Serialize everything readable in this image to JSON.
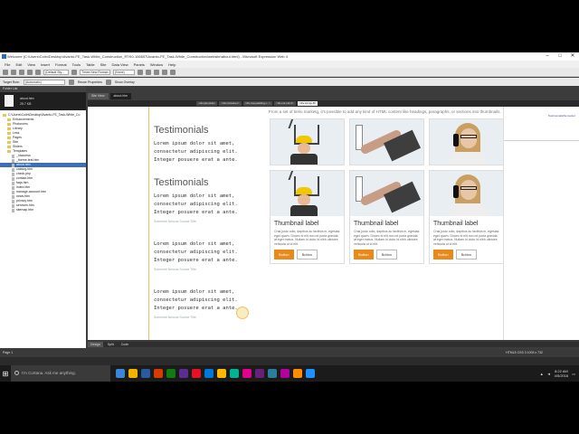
{
  "window": {
    "title": "Welcome (C:\\Users\\Colin\\Desktop\\Avanto-FE_Task-White_Construction_RTK0-106657\\Avanto-FE_Task-White_Construction\\website\\about.html) - Microsoft Expression Web 4",
    "minimize": "–",
    "maximize": "□",
    "close": "✕"
  },
  "menu": [
    "File",
    "Edit",
    "View",
    "Insert",
    "Format",
    "Tools",
    "Table",
    "Site",
    "Data View",
    "Panels",
    "Window",
    "Help"
  ],
  "toolbar": {
    "style_select": "(Default Sty...",
    "font_select": "Times New Roman",
    "size_select": "(None)",
    "target_rule_label": "Target Rule:",
    "target_rule_value": "(Automatic)",
    "reuse_properties": "Reuse Properties",
    "show_overlay": "Show Overlay"
  },
  "folder_panel": {
    "header": "Folder List",
    "file_name": "about.htm",
    "file_size": "25.7 KB",
    "tree": [
      {
        "label": "C:\\Users\\Colin\\Desktop\\Avanto-FE_Task-White_Co",
        "type": "folder",
        "indent": 0
      },
      {
        "label": "Enhancements",
        "type": "folder",
        "indent": 1
      },
      {
        "label": "Photoroms",
        "type": "folder",
        "indent": 1
      },
      {
        "label": "Library",
        "type": "folder",
        "indent": 1
      },
      {
        "label": "Less",
        "type": "folder",
        "indent": 1
      },
      {
        "label": "Pages",
        "type": "folder",
        "indent": 1
      },
      {
        "label": "Site",
        "type": "folder",
        "indent": 1
      },
      {
        "label": "Sliders",
        "type": "folder",
        "indent": 1
      },
      {
        "label": "Templates",
        "type": "folder",
        "indent": 1
      },
      {
        "label": "_htaccess",
        "type": "file",
        "indent": 2
      },
      {
        "label": "_theme-test.htm",
        "type": "file",
        "indent": 2
      },
      {
        "label": "about.htm",
        "type": "file",
        "indent": 2,
        "selected": true
      },
      {
        "label": "catalog.htm",
        "type": "file",
        "indent": 2
      },
      {
        "label": "check.php",
        "type": "file",
        "indent": 2
      },
      {
        "label": "contact.htm",
        "type": "file",
        "indent": 2
      },
      {
        "label": "faqs.htm",
        "type": "file",
        "indent": 2
      },
      {
        "label": "index.htm",
        "type": "file",
        "indent": 2
      },
      {
        "label": "manage-account.htm",
        "type": "file",
        "indent": 2
      },
      {
        "label": "news.htm",
        "type": "file",
        "indent": 2
      },
      {
        "label": "privacy.htm",
        "type": "file",
        "indent": 2
      },
      {
        "label": "services.htm",
        "type": "file",
        "indent": 2
      },
      {
        "label": "sitemap.htm",
        "type": "file",
        "indent": 2
      }
    ]
  },
  "doc_tabs": [
    "Site View",
    "about.htm"
  ],
  "tag_selector": [
    "<div.qfe-wide>",
    "<div.container>",
    "<div.row.padding-t...>",
    "<div.col-md-4>",
    "<div.col-sp-8>"
  ],
  "canvas": {
    "right_link": "Testimonials/Semester",
    "intro_text": "From a set of tirelo marketg, it's possible to add any kind of HTML content like headings, paragraphs, or sections into thumbnails.",
    "testimonials": [
      {
        "heading": "Testimonials",
        "quote": "Lorem ipsum dolor sit amet, consectetur adipiscing elit. Integer posuere erat a ante.",
        "source": ""
      },
      {
        "heading": "Testimonials",
        "quote": "Lorem ipsum dolor sit amet, consectetur adipiscing elit. Integer posuere erat a ante.",
        "source": "Someone famous Source Title"
      },
      {
        "heading": "",
        "quote": "Lorem ipsum dolor sit amet, consectetur adipiscing elit. Integer posuere erat a ante.",
        "source": "Someone famous Source Title"
      },
      {
        "heading": "",
        "quote": "Lorem ipsum dolor sit amet, consectetur adipiscing elit. Integer posuere erat a ante.",
        "source": "Someone famous Source Title"
      }
    ],
    "cards": [
      {
        "image": "worker-house",
        "title": "",
        "desc": "",
        "primary": "",
        "secondary": ""
      },
      {
        "image": "painter-roller",
        "title": "",
        "desc": "",
        "primary": "",
        "secondary": ""
      },
      {
        "image": "woman-phone",
        "title": "",
        "desc": "",
        "primary": "",
        "secondary": ""
      },
      {
        "image": "worker-house",
        "title": "Thumbnail label",
        "desc": "Cras justo odio, dapibus ac facilisis in, egestas eget quam. Donec id elit non mi porta gravida at eget metus. Nullam id dolor id nibh ultricies vehicula ut id elit.",
        "primary": "Button",
        "secondary": "Button"
      },
      {
        "image": "painter-roller",
        "title": "Thumbnail label",
        "desc": "Cras justo odio, dapibus ac facilisis in, egestas eget quam. Donec id elit non mi porta gravida at eget metus. Nullam id dolor id nibh ultricies vehicula ut id elit.",
        "primary": "Button",
        "secondary": "Button"
      },
      {
        "image": "woman-phone",
        "title": "Thumbnail label",
        "desc": "Cras justo odio, dapibus ac facilisis in, egestas eget quam. Donec id elit non mi porta gravida at eget metus. Nullam id dolor id nibh ultricies vehicula ut id elit.",
        "primary": "Button",
        "secondary": "Button"
      }
    ]
  },
  "view_tabs": [
    "Design",
    "Split",
    "Code"
  ],
  "status": {
    "left": "Page 1",
    "right": "HTML5   CSS 3   1003 x 732"
  },
  "taskbar": {
    "search_placeholder": "I'm Cortana. Ask me anything.",
    "time": "8:22 AM",
    "date": "4/5/2016",
    "colors": [
      "#3a86d8",
      "#f2b200",
      "#2c5aa0",
      "#d83b01",
      "#107c10",
      "#5c2d91",
      "#e81123",
      "#0078d7",
      "#ffb900",
      "#00b294",
      "#e3008c",
      "#68217a",
      "#2d7d9a",
      "#b4009e",
      "#ff8c00",
      "#1e90ff"
    ]
  }
}
